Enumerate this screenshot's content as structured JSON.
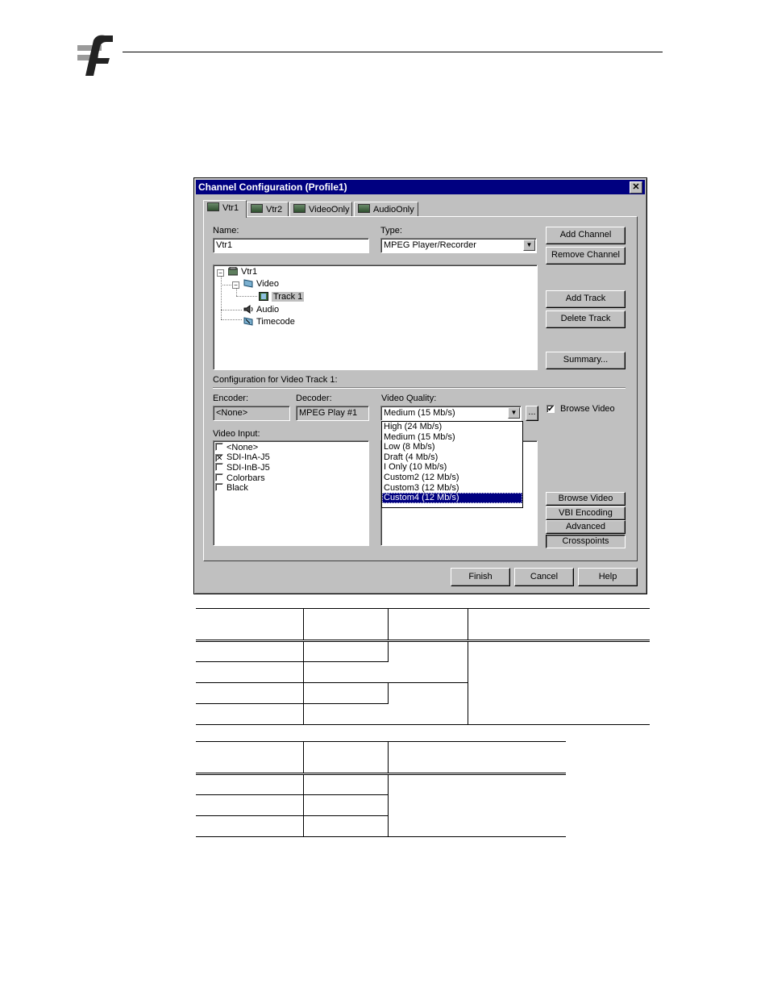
{
  "dialog": {
    "title": "Channel Configuration (Profile1)",
    "close_glyph": "✕",
    "tabs": [
      {
        "label": "Vtr1",
        "active": true
      },
      {
        "label": "Vtr2",
        "active": false
      },
      {
        "label": "VideoOnly",
        "active": false
      },
      {
        "label": "AudioOnly",
        "active": false
      }
    ],
    "name_label": "Name:",
    "name_value": "Vtr1",
    "type_label": "Type:",
    "type_value": "MPEG Player/Recorder",
    "buttons": {
      "add_channel": "Add Channel",
      "remove_channel": "Remove Channel",
      "add_track": "Add Track",
      "delete_track": "Delete Track",
      "summary": "Summary...",
      "browse_video": "Browse Video",
      "vbi_encoding": "VBI Encoding",
      "advanced": "Advanced",
      "crosspoints": "Crosspoints",
      "finish": "Finish",
      "cancel": "Cancel",
      "help": "Help",
      "ellipsis": "..."
    },
    "tree": {
      "root": "Vtr1",
      "video": "Video",
      "track": "Track 1",
      "audio": "Audio",
      "timecode": "Timecode",
      "expanded_glyph": "−"
    },
    "config_label": "Configuration for Video Track 1:",
    "encoder_label": "Encoder:",
    "encoder_value": "<None>",
    "decoder_label": "Decoder:",
    "decoder_value": "MPEG Play #1",
    "quality_label": "Video Quality:",
    "quality_value": "Medium (15 Mb/s)",
    "quality_options": [
      "High (24 Mb/s)",
      "Medium (15 Mb/s)",
      "Low (8 Mb/s)",
      "Draft (4 Mb/s)",
      "I Only (10 Mb/s)",
      "Custom2 (12 Mb/s)",
      "Custom3 (12 Mb/s)",
      "Custom4 (12 Mb/s)"
    ],
    "quality_highlighted": "Custom4 (12 Mb/s)",
    "browse_video_checkbox": {
      "label": "Browse Video",
      "checked": true,
      "glyph": "✔"
    },
    "video_input_label": "Video Input:",
    "video_inputs": [
      {
        "label": "<None>",
        "checked": false
      },
      {
        "label": "SDI-InA-J5",
        "checked": true
      },
      {
        "label": "SDI-InB-J5",
        "checked": false
      },
      {
        "label": "Colorbars",
        "checked": false
      },
      {
        "label": "Black",
        "checked": false
      }
    ],
    "check_glyph": "✕"
  },
  "colors": {
    "titlebar": "#000080",
    "dialog_face": "#c0c0c0",
    "highlight": "#000080"
  }
}
